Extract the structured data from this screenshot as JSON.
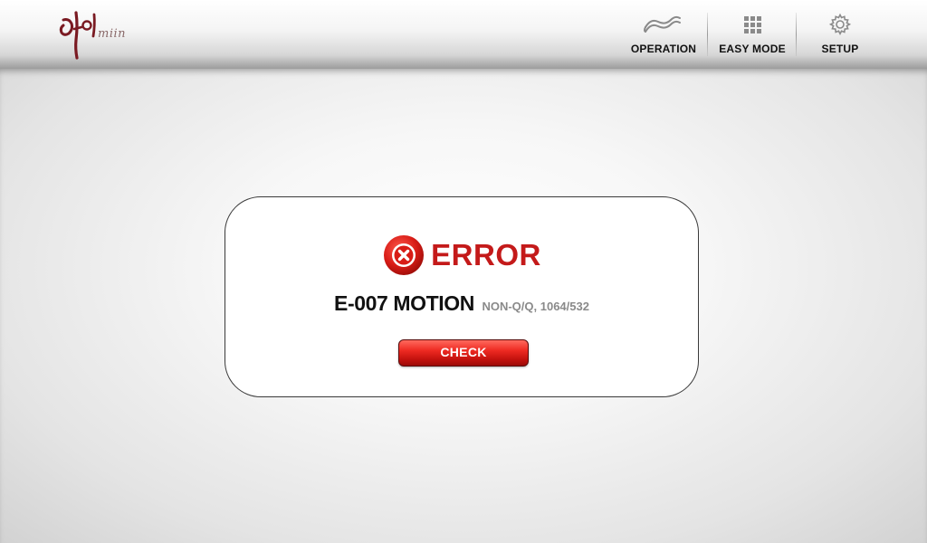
{
  "header": {
    "logo_text": "miin",
    "nav": [
      {
        "label": "OPERATION",
        "icon": "operation-wave-icon"
      },
      {
        "label": "EASY MODE",
        "icon": "grid-icon"
      },
      {
        "label": "SETUP",
        "icon": "gear-icon"
      }
    ]
  },
  "dialog": {
    "title": "ERROR",
    "icon": "error-x-icon",
    "code": "E-007 MOTION",
    "detail": "NON-Q/Q, 1064/532",
    "button_label": "CHECK"
  },
  "colors": {
    "error_red": "#c41a1a",
    "button_red": "#e0231b",
    "logo_maroon": "#7a1a22"
  }
}
